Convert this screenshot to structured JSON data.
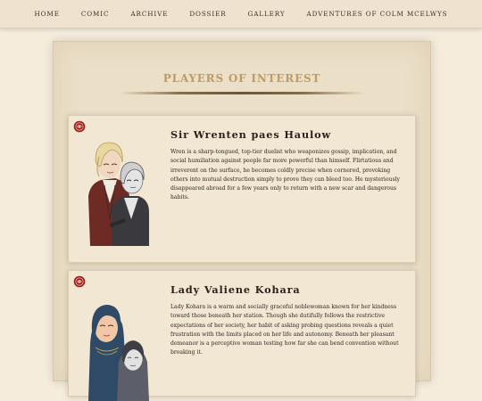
{
  "nav": {
    "items": [
      "HOME",
      "COMIC",
      "ARCHIVE",
      "DOSSIER",
      "GALLERY",
      "ADVENTURES OF COLM MCELWYS"
    ]
  },
  "section": {
    "title": "PLAYERS OF INTEREST"
  },
  "characters": [
    {
      "name": "Sir Wrenten paes Haulow",
      "bio": "Wren is a sharp-tongued, top-tier duelist who weaponizes gossip, implication, and social humiliation against people far more powerful than himself. Flirtatious and irreverent on the surface, he becomes coldly precise when cornered, provoking others into mutual destruction simply to prove they can bleed too. He mysteriously disappeared abroad for a few years only to return with a new scar and dangerous habits."
    },
    {
      "name": "Lady Valiene Kohara",
      "bio": "Lady Kohara is a warm and socially graceful noblewoman known for her kindness toward those beneath her station. Though she dutifully follows the restrictive expectations of her society, her habit of asking probing questions reveals a quiet frustration with the limits placed on her life and autonomy. Beneath her pleasant demeanor is a perceptive woman testing how far she can bend convention without breaking it."
    }
  ],
  "colors": {
    "background": "#f5ecdc",
    "panel": "#ebdfc8",
    "card": "#f2e7d3",
    "title_accent": "#c09a63",
    "rose": "#9e1b1b"
  },
  "icons": {
    "card_badge": "rose-icon"
  }
}
